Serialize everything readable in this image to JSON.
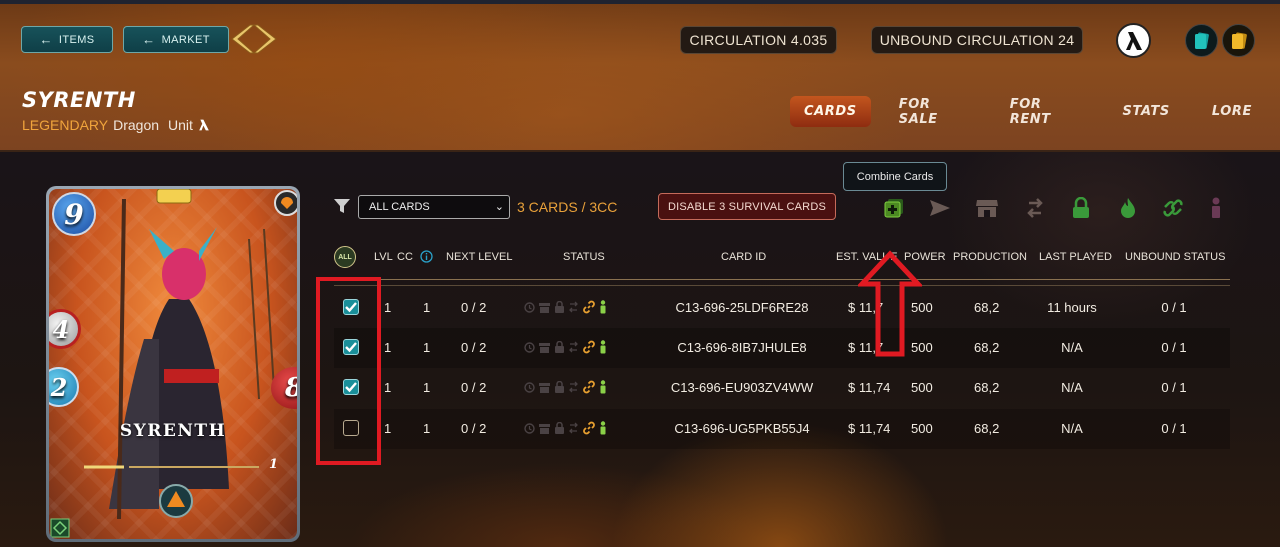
{
  "header": {
    "items_label": "ITEMS",
    "market_label": "MARKET",
    "circulation": "CIRCULATION 4.035",
    "unbound_circulation": "UNBOUND CIRCULATION 24",
    "card_title": "SYRENTH",
    "rarity": "LEGENDARY",
    "element": "Dragon",
    "type": "Unit",
    "tabs": [
      "CARDS",
      "FOR SALE",
      "FOR RENT",
      "STATS",
      "LORE"
    ],
    "active_tab": "CARDS"
  },
  "card": {
    "name": "SYRENTH",
    "mana": "9",
    "attack": "4",
    "speed": "2",
    "health": "8",
    "level": "1"
  },
  "toolbar": {
    "filter_selected": "ALL CARDS",
    "count": "3 CARDS / 3CC",
    "survival_button": "DISABLE 3 SURVIVAL CARDS",
    "tooltip": "Combine Cards"
  },
  "table": {
    "all_label": "ALL",
    "headers": {
      "lvl": "LVL",
      "cc": "CC",
      "next_level": "NEXT LEVEL",
      "status": "STATUS",
      "card_id": "CARD ID",
      "est_value": "EST. VALUE",
      "power": "POWER",
      "production": "PRODUCTION",
      "last_played": "LAST PLAYED",
      "unbound_status": "UNBOUND STATUS"
    },
    "rows": [
      {
        "checked": true,
        "lvl": "1",
        "cc": "1",
        "next": "0 / 2",
        "id": "C13-696-25LDF6RE28",
        "value": "$ 11,7",
        "power": "500",
        "prod": "68,2",
        "last": "11 hours",
        "unbound": "0 / 1"
      },
      {
        "checked": true,
        "lvl": "1",
        "cc": "1",
        "next": "0 / 2",
        "id": "C13-696-8IB7JHULE8",
        "value": "$ 11,7",
        "power": "500",
        "prod": "68,2",
        "last": "N/A",
        "unbound": "0 / 1"
      },
      {
        "checked": true,
        "lvl": "1",
        "cc": "1",
        "next": "0 / 2",
        "id": "C13-696-EU903ZV4WW",
        "value": "$ 11,74",
        "power": "500",
        "prod": "68,2",
        "last": "N/A",
        "unbound": "0 / 1"
      },
      {
        "checked": false,
        "lvl": "1",
        "cc": "1",
        "next": "0 / 2",
        "id": "C13-696-UG5PKB55J4",
        "value": "$ 11,74",
        "power": "500",
        "prod": "68,2",
        "last": "N/A",
        "unbound": "0 / 1"
      }
    ]
  },
  "colors": {
    "accent_teal": "#1a8f9a",
    "highlight_red": "#e01a22",
    "count_orange": "#e9a13a",
    "active_icon_green": "#7fd040"
  }
}
